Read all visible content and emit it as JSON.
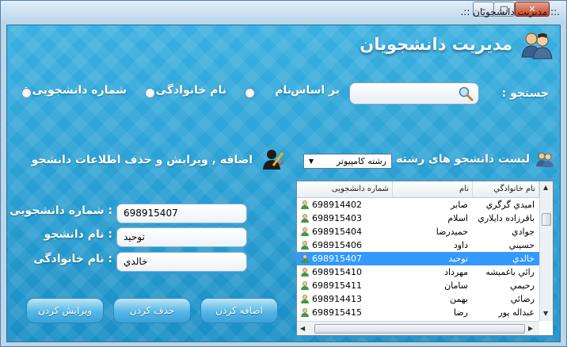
{
  "window": {
    "title": ".:: مديريت دانشجويان ::."
  },
  "header": {
    "title": "مديريت دانشجويان"
  },
  "search": {
    "label": "جستجو :",
    "based_on": "بر اساس :",
    "options": [
      "نام",
      "نام خانوادگی",
      "شماره دانشجویی :"
    ]
  },
  "list_section": {
    "label": "لیست دانشجو های رشته :",
    "selected_major": "رشته کامپیوتر"
  },
  "edit_section": {
    "label": "اضافه , ویرایش و حذف اطلاعات دانشجو"
  },
  "form": {
    "student_number_label": ": شماره دانشجویی",
    "student_number_value": "698915407",
    "first_name_label": ": نام دانشجو",
    "first_name_value": "توحيد",
    "last_name_label": ": نام خانوادگی",
    "last_name_value": "خالدي"
  },
  "buttons": {
    "add": "اضافه کردن",
    "delete": "حذف کردن",
    "edit": "ویرایش کردن"
  },
  "grid": {
    "columns": [
      "شماره دانشجویی",
      "نام",
      "نام خانوادگي"
    ],
    "rows": [
      {
        "number": "698914402",
        "first": "صابر",
        "last": "اميدي گرگري"
      },
      {
        "number": "698915403",
        "first": "اسلام",
        "last": "باقرزاده دایلاري"
      },
      {
        "number": "698915404",
        "first": "حميدرضا",
        "last": "جوادي"
      },
      {
        "number": "698915406",
        "first": "داود",
        "last": "حسيني"
      },
      {
        "number": "698915407",
        "first": "توحيد",
        "last": "خالدي"
      },
      {
        "number": "698915410",
        "first": "مهرداد",
        "last": "رائي باغميشه"
      },
      {
        "number": "698915411",
        "first": "سامان",
        "last": "رحيمي"
      },
      {
        "number": "698914413",
        "first": "بهمن",
        "last": "رضائي"
      },
      {
        "number": "698915415",
        "first": "رضا",
        "last": "عبداله پور"
      }
    ],
    "selected_index": 4
  },
  "colors": {
    "accent": "#1a8fc6",
    "selection": "#3399ff"
  }
}
